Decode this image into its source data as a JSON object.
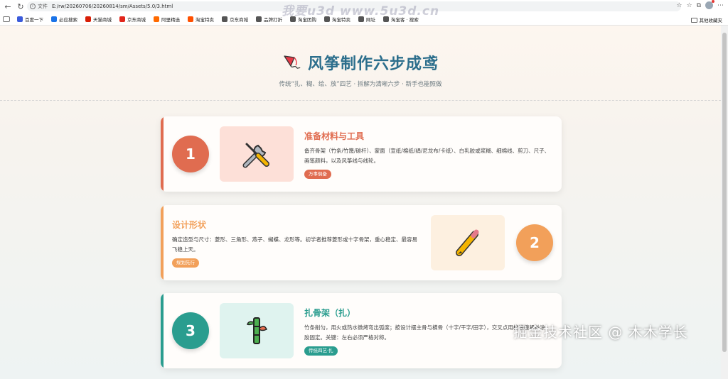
{
  "browser": {
    "scheme_label": "文件",
    "url": "E:/rw/20260706/20260814/sm/Assets/5.0/3.html",
    "bookmarks": [
      {
        "label": "百度一下",
        "color": "#3b5bdb"
      },
      {
        "label": "必应搜索",
        "color": "#1a73e8"
      },
      {
        "label": "天猫商城",
        "color": "#d81e06"
      },
      {
        "label": "京东商城",
        "color": "#e1251b"
      },
      {
        "label": "阿里精选",
        "color": "#ff6a00"
      },
      {
        "label": "淘宝特卖",
        "color": "#ff5000"
      },
      {
        "label": "京东商城",
        "color": "#555555"
      },
      {
        "label": "品牌打折",
        "color": "#555555"
      },
      {
        "label": "淘宝团购",
        "color": "#555555"
      },
      {
        "label": "淘宝特卖",
        "color": "#555555"
      },
      {
        "label": "网址",
        "color": "#555555"
      },
      {
        "label": "淘宝客 · 搜索",
        "color": "#555555"
      }
    ],
    "other_bookmarks": "其他收藏夹"
  },
  "page": {
    "title": "风筝制作六步成鸢",
    "subtitle": "传统“扎、糊、绘、放”四艺 · 拆解为清晰六步 · 新手也能照做"
  },
  "steps": [
    {
      "number": "1",
      "title": "准备材料与工具",
      "description": "备齐骨架（竹条/竹篾/碳杆）、蒙面（宣纸/棉纸/绢/尼龙布/卡纸）、白乳胶或浆糊、细棉线、剪刀、尺子、画笔颜料，以及风筝线与线轮。",
      "tag": "万事俱备",
      "icon": "tools-icon",
      "color": "#e06c50",
      "soft": "#fde0d8"
    },
    {
      "number": "2",
      "title": "设计形状",
      "description": "确定造型与尺寸：菱形、三角形、燕子、蝴蝶、龙形等。初学者推荐菱形或十字骨架，重心稳定、最容易飞稳上天。",
      "tag": "规划先行",
      "icon": "pencil-icon",
      "color": "#f2a05a",
      "soft": "#fdf0e0"
    },
    {
      "number": "3",
      "title": "扎骨架（扎）",
      "description": "竹条削匀，用火或热水微烤弯出弧度；按设计摆主骨与横骨（十字/干字/田字），交叉点用棉线缠紧并涂胶固定。关键：左右必须严格对称。",
      "tag": "传统四艺·扎",
      "icon": "bamboo-icon",
      "color": "#2a9d8f",
      "soft": "#dff3ef"
    }
  ],
  "watermarks": {
    "top": "我要u3d www.5u3d.cn",
    "bottom": "掘金技术社区 @ 木木学长"
  }
}
